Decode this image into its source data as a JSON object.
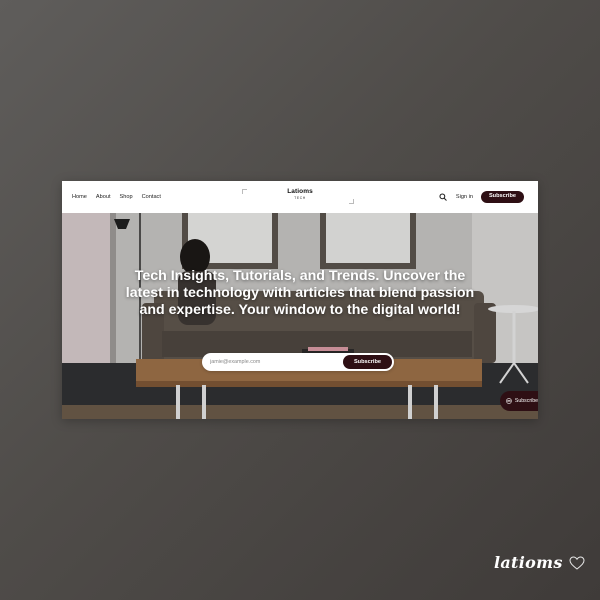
{
  "nav": {
    "links": [
      "Home",
      "About",
      "Shop",
      "Contact"
    ]
  },
  "logo": {
    "name": "Latioms",
    "tagline": "TECH"
  },
  "header": {
    "signin_label": "Sign in",
    "subscribe_label": "Subscribe",
    "search_icon": "search-icon"
  },
  "hero": {
    "title": "Tech Insights, Tutorials, and Trends. Uncover the latest in technology with articles that blend passion and expertise. Your window to the digital world!",
    "email_placeholder": "jamie@example.com",
    "email_value": "",
    "subscribe_label": "Subscribe"
  },
  "floating_subscribe": {
    "label": "Subscribe",
    "icon": "envelope-icon"
  },
  "brand_mark": {
    "text": "latioms",
    "icon": "heart-icon"
  },
  "colors": {
    "accent": "#2e0f14",
    "header_bg": "#ffffff",
    "backdrop": "#4f4c49"
  }
}
